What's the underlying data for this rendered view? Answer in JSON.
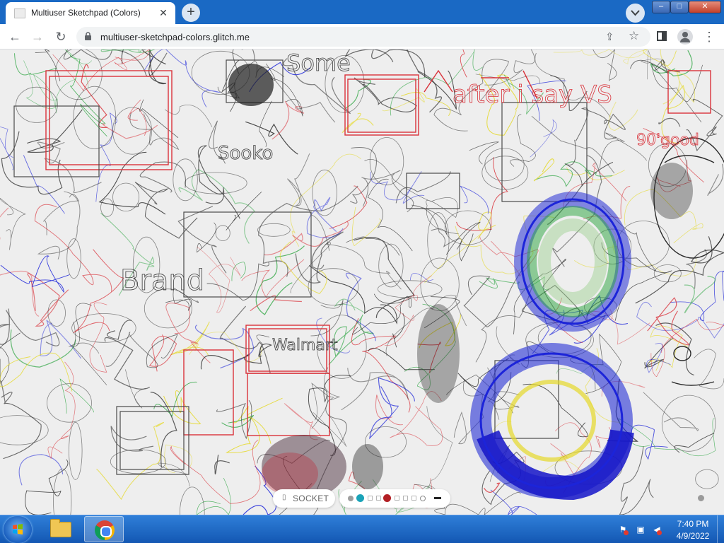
{
  "browser": {
    "tab_title": "Multiuser Sketchpad (Colors)",
    "tab_close_icon": "close-icon",
    "new_tab_label": "+",
    "url": "multiuser-sketchpad-colors.glitch.me"
  },
  "window_controls": {
    "minimize": "–",
    "maximize": "□",
    "close": "✕"
  },
  "sketchpad": {
    "socket_label": "SOCKET",
    "palette": [
      {
        "name": "gray",
        "color": "#9e9e9e"
      },
      {
        "name": "teal",
        "color": "#1aa3b8"
      },
      {
        "name": "white-square-1",
        "color": "#ffffff"
      },
      {
        "name": "white-square-2",
        "color": "#ffffff"
      },
      {
        "name": "dark-red",
        "color": "#b21f24"
      },
      {
        "name": "white-square-3",
        "color": "#ffffff"
      },
      {
        "name": "white-square-4",
        "color": "#ffffff"
      },
      {
        "name": "white-square-5",
        "color": "#ffffff"
      },
      {
        "name": "white-circle",
        "color": "#ffffff"
      }
    ],
    "canvas_text": {
      "some": "Some",
      "soko": "Sooko",
      "walmart": "Walmart",
      "banner": "after i say VS",
      "brand": "Brand",
      "good": "90'good"
    },
    "stroke_colors": {
      "black": "#2b2b2b",
      "red": "#d9323a",
      "blue": "#1c24d9",
      "green": "#27a33c",
      "yellow": "#e5d92a"
    }
  },
  "taskbar": {
    "time": "7:40 PM",
    "date": "4/9/2022"
  }
}
